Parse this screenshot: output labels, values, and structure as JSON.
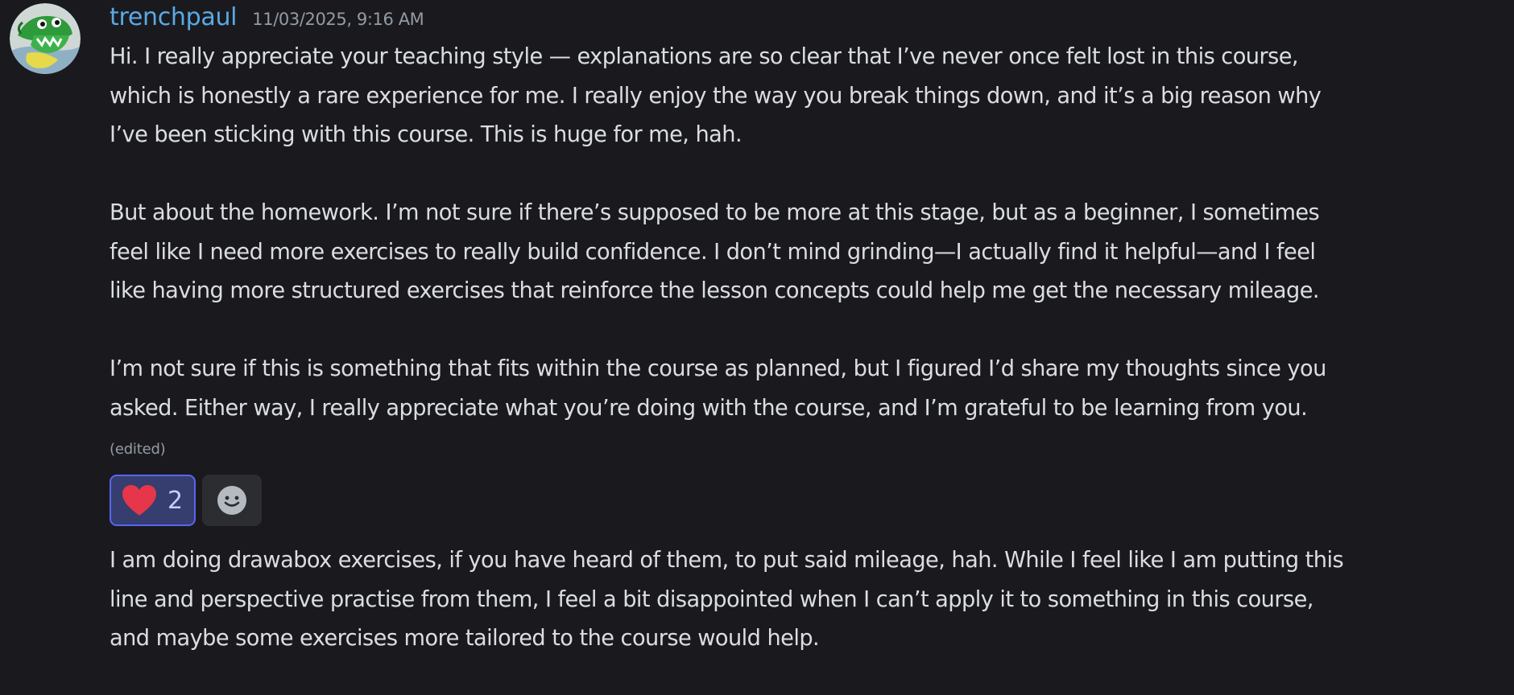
{
  "message": {
    "author": "trenchpaul",
    "timestamp": "11/03/2025, 9:16 AM",
    "paragraphs": [
      [
        "Hi. I really appreciate your teaching style — explanations are so clear that I’ve never once felt lost in this course,",
        "which is honestly a rare experience for me. I really enjoy the way you break things down, and it’s a big reason why",
        "I’ve been sticking with this course. This is huge for me, hah."
      ],
      [
        "But  about the homework. I’m not sure if there’s supposed to be more at this stage, but as a beginner, I sometimes",
        "feel like I need more exercises to really build confidence. I don’t mind grinding—I actually find it helpful—and I feel",
        "like having more structured exercises that reinforce the lesson concepts could help me get the necessary mileage."
      ],
      [
        "I’m not sure if this is something that fits within the course as planned, but I figured I’d share my thoughts since you",
        "asked. Either way, I really appreciate what you’re doing with the course, and I’m grateful to be learning from you."
      ]
    ],
    "edited_label": "(edited)",
    "reactions": [
      {
        "emoji": "heart-icon",
        "count": "2",
        "reacted_by_me": true
      }
    ],
    "add_reaction_icon": "add-reaction-icon"
  },
  "followup_message": {
    "paragraphs": [
      [
        "I am doing drawabox exercises, if you have heard of them, to put said mileage, hah. While I feel like I am putting this",
        "line and perspective practise from them, I feel a bit disappointed when I can’t apply it to something in this course,",
        "and maybe some exercises more tailored to the course would help."
      ]
    ]
  },
  "colors": {
    "background": "#1a1a1e",
    "username": "#5aa9e6",
    "text": "#dbdee1",
    "muted": "#949ba4",
    "reaction_active_bg": "#353e6e",
    "reaction_active_border": "#5865f2",
    "heart": "#e5364a"
  }
}
